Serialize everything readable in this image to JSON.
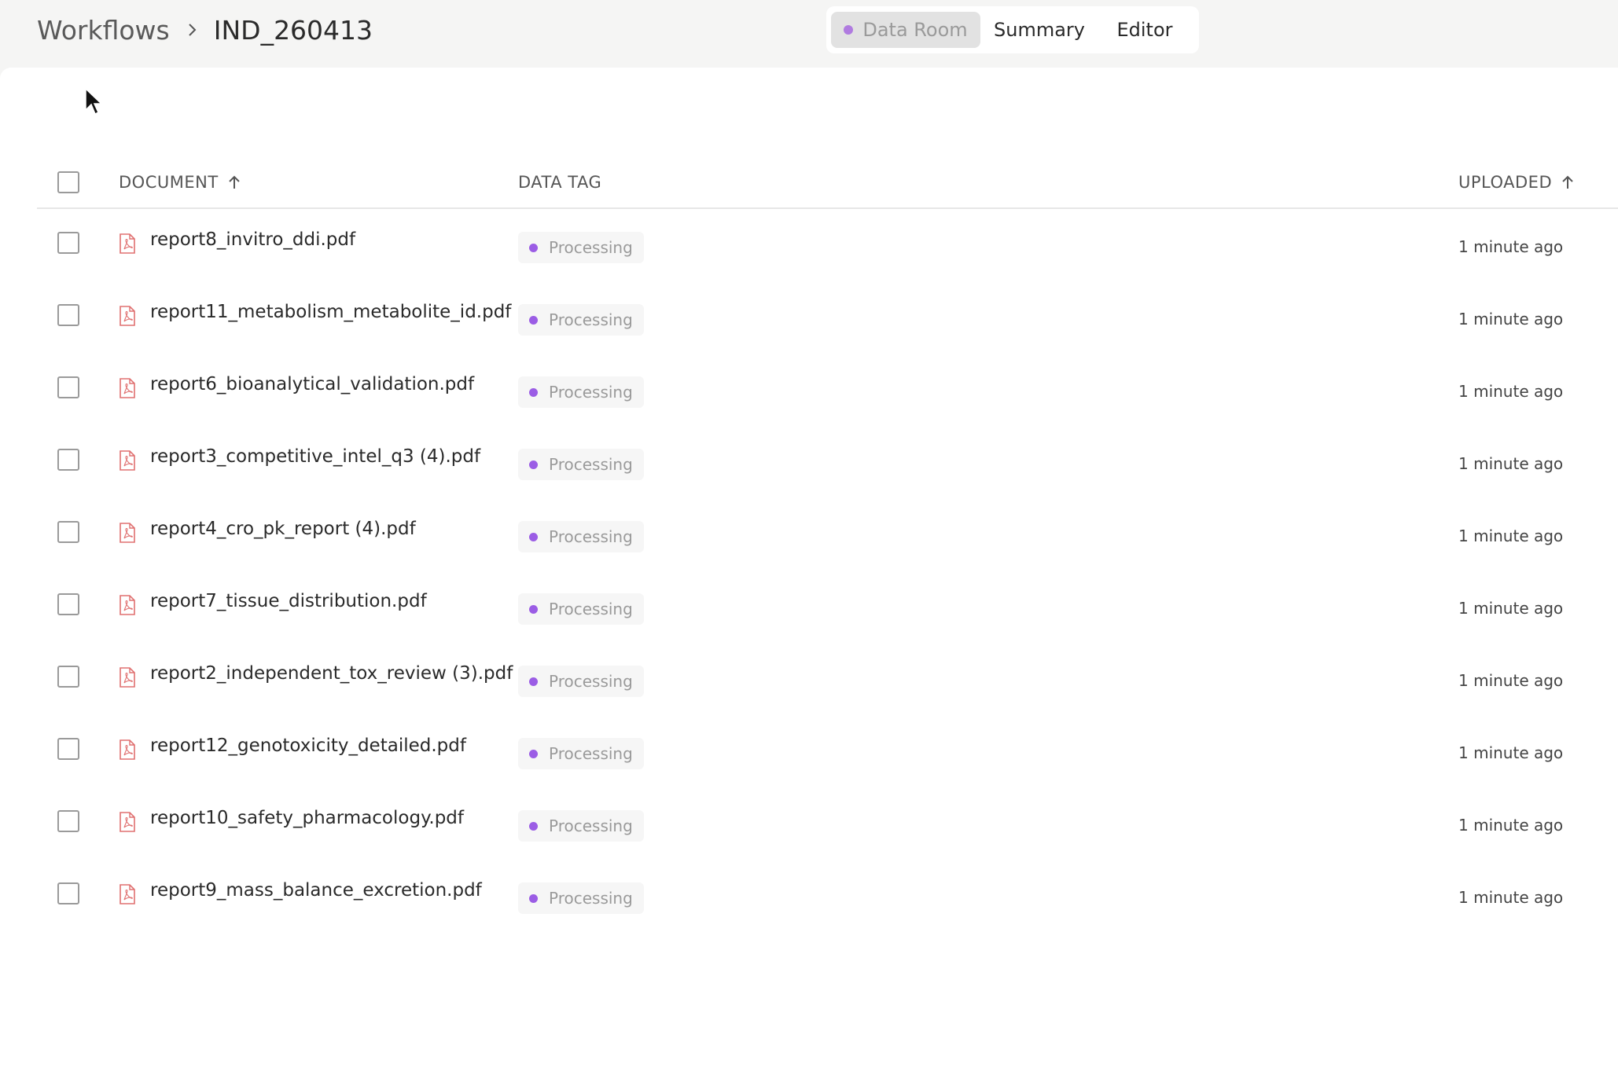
{
  "breadcrumb": {
    "root": "Workflows",
    "current": "IND_260413"
  },
  "view_tabs": [
    {
      "label": "Data Room",
      "active": true
    },
    {
      "label": "Summary",
      "active": false
    },
    {
      "label": "Editor",
      "active": false
    }
  ],
  "table": {
    "headers": {
      "document": "DOCUMENT",
      "data_tag": "DATA TAG",
      "uploaded": "UPLOADED"
    },
    "rows": [
      {
        "name": "report8_invitro_ddi.pdf",
        "tag": "Processing",
        "uploaded": "1 minute ago"
      },
      {
        "name": "report11_metabolism_metabolite_id.pdf",
        "tag": "Processing",
        "uploaded": "1 minute ago"
      },
      {
        "name": "report6_bioanalytical_validation.pdf",
        "tag": "Processing",
        "uploaded": "1 minute ago"
      },
      {
        "name": "report3_competitive_intel_q3 (4).pdf",
        "tag": "Processing",
        "uploaded": "1 minute ago"
      },
      {
        "name": "report4_cro_pk_report (4).pdf",
        "tag": "Processing",
        "uploaded": "1 minute ago"
      },
      {
        "name": "report7_tissue_distribution.pdf",
        "tag": "Processing",
        "uploaded": "1 minute ago"
      },
      {
        "name": "report2_independent_tox_review (3).pdf",
        "tag": "Processing",
        "uploaded": "1 minute ago"
      },
      {
        "name": "report12_genotoxicity_detailed.pdf",
        "tag": "Processing",
        "uploaded": "1 minute ago"
      },
      {
        "name": "report10_safety_pharmacology.pdf",
        "tag": "Processing",
        "uploaded": "1 minute ago"
      },
      {
        "name": "report9_mass_balance_excretion.pdf",
        "tag": "Processing",
        "uploaded": "1 minute ago"
      }
    ]
  },
  "colors": {
    "accent_dot": "#9b5de5",
    "pdf_icon": "#e07070"
  }
}
